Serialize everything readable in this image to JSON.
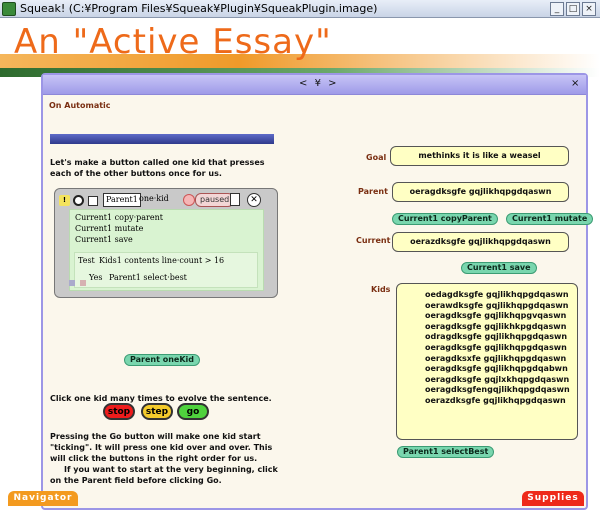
{
  "window": {
    "title": "Squeak! (C:¥Program Files¥Squeak¥Plugin¥SqueakPlugin.image)",
    "min_glyph": "_",
    "max_glyph": "□",
    "close_glyph": "×"
  },
  "page": {
    "title": "An \"Active Essay\""
  },
  "book": {
    "nav_prev": "<",
    "nav_menu": "¥",
    "nav_next": ">",
    "close": "×"
  },
  "section": {
    "title": "On Automatic",
    "intro": "Let's make a button called one kid that presses each of the other buttons once for us."
  },
  "script": {
    "bang": "!",
    "target": "Parent1",
    "name": "one·kid",
    "status": "paused",
    "close": "✕",
    "commands": [
      "Current1 copy·parent",
      "Current1 mutate",
      "Current1 save"
    ],
    "test_label": "Test",
    "test_condition": "Kids1 contents line·count > 16",
    "yes_label": "Yes",
    "yes_command": "Parent1 select·best"
  },
  "buttons": {
    "parent_onekid": "Parent oneKid",
    "copy_parent": "Current1 copyParent",
    "mutate": "Current1 mutate",
    "save": "Current1 save",
    "select_best": "Parent1 selectBest",
    "stop": "stop",
    "step": "step",
    "go": "go"
  },
  "texts": {
    "click": "Click one kid many times to evolve the sentence.",
    "go_para": "Pressing the Go button will make one kid start \"ticking\".  It will press one kid over and over.  This will click the buttons in the right order for us.",
    "go_para2": "If you want to start at the very beginning, click on the Parent field before clicking  Go."
  },
  "labels": {
    "goal": "Goal",
    "parent": "Parent",
    "current": "Current",
    "kids": "Kids"
  },
  "fields": {
    "goal": "methinks it is like a weasel",
    "parent": "oeragdksgfe gqjlikhqpgdqaswn",
    "current": "oerazdksgfe gqjlikhqpgdqaswn",
    "kids": [
      "oedagdksgfe gqjlikhqpgdqaswn",
      "oerawdksgfe gqjlikhqpgdqaswn",
      "oeragdksgfe gqjlikhqpgvqaswn",
      "oeragdksgfe gqjlikhkpgdqaswn",
      "odragdksgfe gqjlikhqpgdqaswn",
      "oeragdksgfe gqjlikhqpgdqaswn",
      "oeragdksxfe gqjlikhqpgdqaswn",
      "oeragdksgfe gqjlikhqpgdqabwn",
      "oeragdksgfe gqjlxkhqpgdqaswn",
      "oeragdksgfengqjlikhqpgdqaswn",
      "oerazdksgfe gqjlikhqpgdqaswn"
    ]
  },
  "flaps": {
    "navigator": "Navigator",
    "supplies": "Supplies"
  },
  "colors": {
    "title_orange": "#ee6a1a",
    "book_border": "#9c96e6",
    "green_button": "#79d6ae",
    "field_yellow": "#ffffc4",
    "stop_red": "#ee1c1c",
    "step_yellow": "#f4cb2c",
    "go_green": "#4fd23d"
  }
}
